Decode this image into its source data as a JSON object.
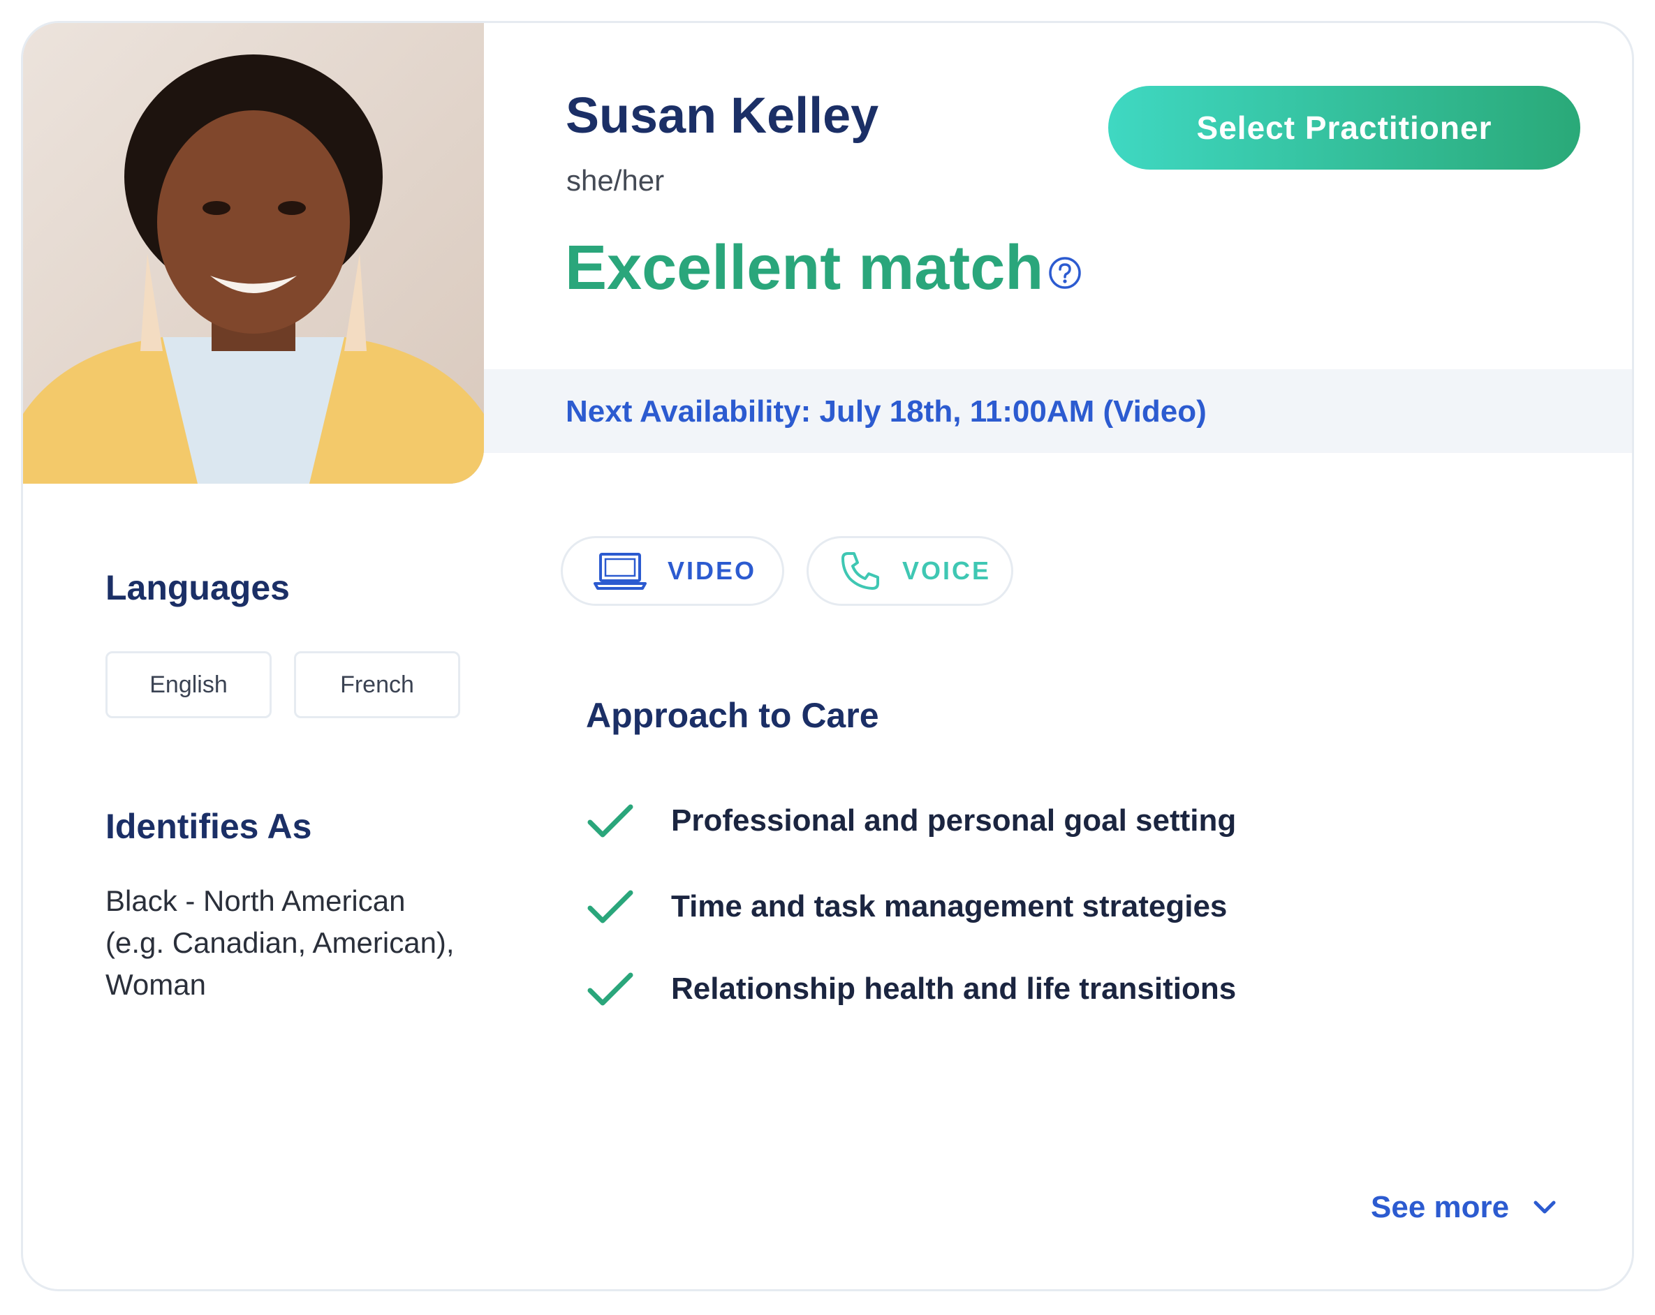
{
  "practitioner": {
    "name": "Susan Kelley",
    "pronouns": "she/her",
    "match": "Excellent match",
    "select_label": "Select Practitioner"
  },
  "availability": {
    "text": "Next Availability: July 18th, 11:00AM (Video)"
  },
  "modes": [
    {
      "label": "VIDEO",
      "icon": "laptop-icon"
    },
    {
      "label": "VOICE",
      "icon": "phone-icon"
    }
  ],
  "languages": {
    "title": "Languages",
    "items": [
      "English",
      "French"
    ]
  },
  "identifies": {
    "title": "Identifies As",
    "lines": [
      "Black - North American",
      "(e.g. Canadian, American),",
      "Woman"
    ]
  },
  "care": {
    "title": "Approach to Care",
    "items": [
      "Professional and personal goal setting",
      "Time and task management strategies",
      "Relationship health and life transitions"
    ]
  },
  "see_more": "See more",
  "colors": {
    "navy": "#1b2f66",
    "green": "#2aa67b",
    "blue": "#2c5bd0",
    "teal": "#3fc7b3"
  }
}
